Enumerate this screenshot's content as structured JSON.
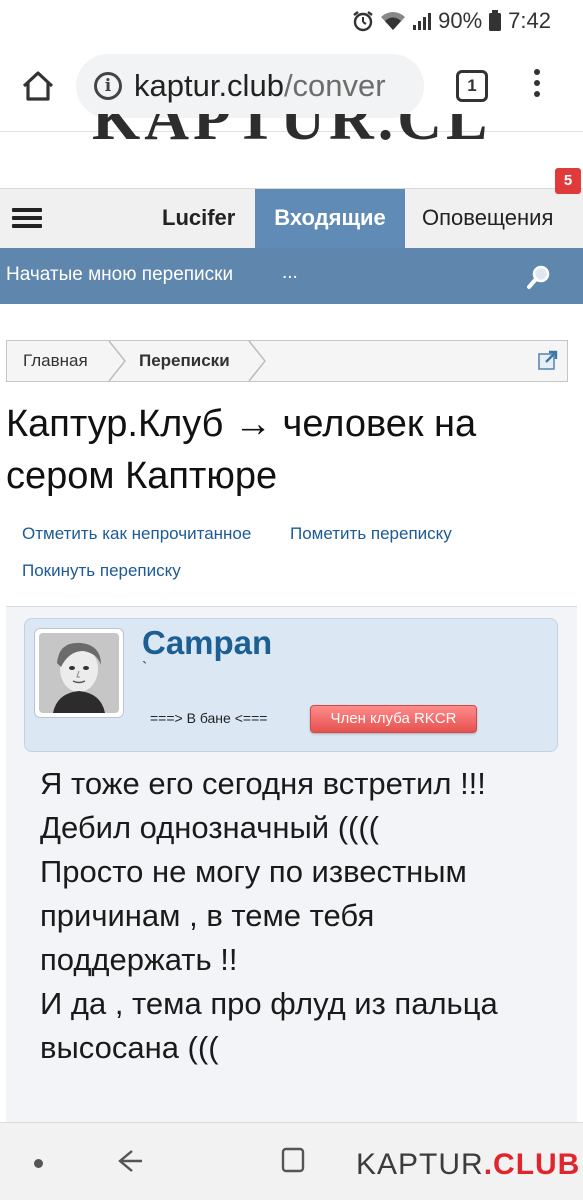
{
  "status_bar": {
    "battery": "90%",
    "time": "7:42"
  },
  "browser": {
    "url_domain": "kaptur.club",
    "url_path": "/conver",
    "tab_count": "1"
  },
  "site": {
    "logo_text": "KAPTUR.CLUB"
  },
  "nav": {
    "user": "Lucifer",
    "inbox": "Входящие",
    "alerts": "Оповещения",
    "alerts_badge": "5"
  },
  "subnav": {
    "started_by_me": "Начатые мною переписки",
    "more": "..."
  },
  "breadcrumb": {
    "home": "Главная",
    "current": "Переписки"
  },
  "page": {
    "title": "Каптур.Клуб → человек на сером Каптюре"
  },
  "actions": {
    "mark_unread": "Отметить как непрочитанное",
    "star": "Пометить переписку",
    "leave": "Покинуть переписку"
  },
  "message": {
    "username": "Campan",
    "user_title": "`",
    "ban_status": "===> В бане <===",
    "member_badge": "Член клуба RKCR",
    "body": "Я тоже его сегодня встретил !!!\nДебил однозначный ((((\nПросто не могу по известным причинам , в теме тебя поддержать !!\nИ да , тема про флуд из пальца высосана ((("
  },
  "watermark": {
    "part1": "KAPTUR",
    "part2": ".CLUB"
  },
  "colors": {
    "tab_active": "#5f8bb6",
    "subnav_bg": "#5f87ad",
    "link": "#1d5a96",
    "username": "#1b5f93",
    "badge": "#e03a3a"
  }
}
